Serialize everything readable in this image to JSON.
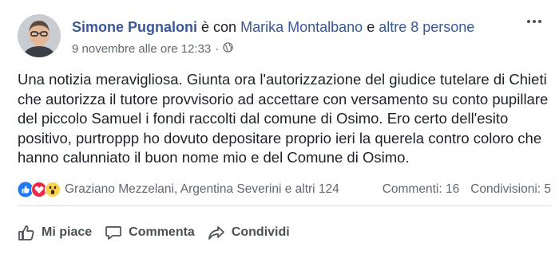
{
  "post": {
    "author": "Simone Pugnaloni",
    "with_text": "è con",
    "tagged_person": "Marika Montalbano",
    "and_text": "e",
    "others_link": "altre 8 persone",
    "timestamp": "9 novembre alle ore 12:33",
    "separator": "·",
    "privacy_icon": "globe-icon",
    "text": "Una notizia meravigliosa. Giunta ora l'autorizzazione del giudice tutelare di Chieti che autorizza il tutore provvisorio ad accettare con versamento su conto pupillare del piccolo Samuel i fondi raccolti dal comune di Osimo. Ero certo dell'esito positivo, purtroppp ho dovuto depositare proprio ieri la querela contro coloro che hanno calunniato il buon nome mio e del Comune di Osimo."
  },
  "reactions": {
    "icons": [
      "like-reaction-icon",
      "love-reaction-icon",
      "wow-reaction-icon"
    ],
    "likers": "Graziano Mezzelani, Argentina Severini e altri 124",
    "comments": "Commenti: 16",
    "shares": "Condivisioni: 5"
  },
  "actions": {
    "like": "Mi piace",
    "comment": "Commenta",
    "share": "Condividi"
  },
  "colors": {
    "link": "#385898",
    "text": "#1d2129",
    "meta": "#616770",
    "like_blue": "#2078f4",
    "love_red": "#f0284a",
    "wow_yellow": "#fcd34d"
  }
}
